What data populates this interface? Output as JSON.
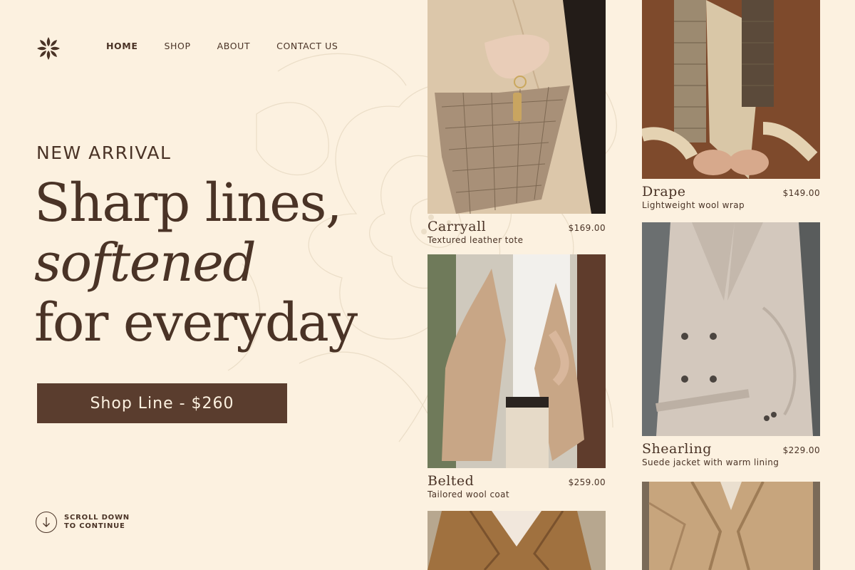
{
  "nav": {
    "items": [
      "HOME",
      "SHOP",
      "ABOUT",
      "CONTACT US"
    ]
  },
  "hero": {
    "eyebrow": "NEW ARRIVAL",
    "line1": "Sharp lines,",
    "line2": "softened",
    "line3": "for everyday",
    "cta": "Shop Line - $260"
  },
  "scroll": {
    "line1": "SCROLL DOWN",
    "line2": "TO CONTINUE"
  },
  "products": {
    "carryall": {
      "name": "Carryall",
      "price": "$169.00",
      "desc": "Textured leather tote"
    },
    "drape": {
      "name": "Drape",
      "price": "$149.00",
      "desc": "Lightweight wool wrap"
    },
    "belted": {
      "name": "Belted",
      "price": "$259.00",
      "desc": "Tailored wool coat"
    },
    "shearling": {
      "name": "Shearling",
      "price": "$229.00",
      "desc": "Suede jacket with warm lining"
    }
  },
  "colors": {
    "background": "#fcf1e0",
    "brand_brown": "#5a3d2e",
    "text": "#4a3326"
  },
  "icons": [
    "flower-logo-icon",
    "arrow-down-icon"
  ]
}
